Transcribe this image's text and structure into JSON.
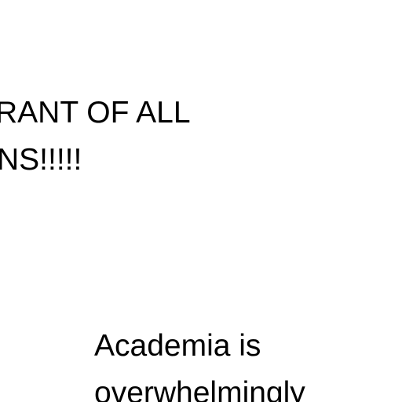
{
  "heading": {
    "line_1": "RANT OF ALL",
    "line_2": "NS!!!!!"
  },
  "body": {
    "line_1": "Academia is",
    "line_2": "overwhelmingly"
  }
}
